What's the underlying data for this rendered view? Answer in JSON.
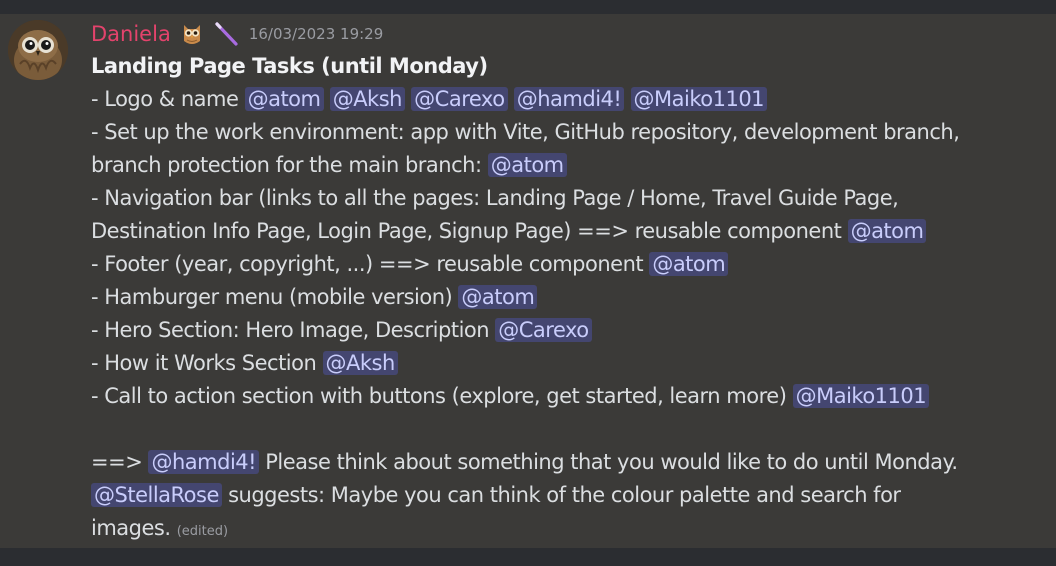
{
  "message": {
    "author": "Daniela",
    "timestamp": "16/03/2023 19:29",
    "author_color": "#e3436c",
    "emojis": [
      "owl-emoji",
      "wand-emoji"
    ],
    "title": "Landing Page Tasks (until Monday)",
    "lines": {
      "l1": "- Logo & name",
      "l2": "- Set up the work environment: app with Vite, GitHub repository, development branch,",
      "l3": "branch protection for the main branch:",
      "l4": "- Navigation bar (links to all the pages: Landing Page / Home, Travel Guide Page,",
      "l5": "Destination Info Page, Login Page, Signup Page) ==> reusable component",
      "l6": "- Footer (year, copyright, ...) ==> reusable component",
      "l7": "- Hamburger menu (mobile version)",
      "l8": "- Hero Section: Hero Image, Description",
      "l9": "- How it Works Section",
      "l10": "- Call to action section with buttons (explore, get started, learn more)",
      "l11_prefix": "==>",
      "l11_suffix": "Please think about something that you would like to do until Monday.",
      "l12_suffix": "suggests: Maybe you can think of the colour palette and search for",
      "l13": "images."
    },
    "edited_label": "(edited)"
  },
  "mentions": {
    "atom": "@atom",
    "aksh": "@Aksh",
    "carexo": "@Carexo",
    "hamdi": "@hamdi4!",
    "maiko": "@Maiko1101",
    "stella": "@StellaRose"
  }
}
